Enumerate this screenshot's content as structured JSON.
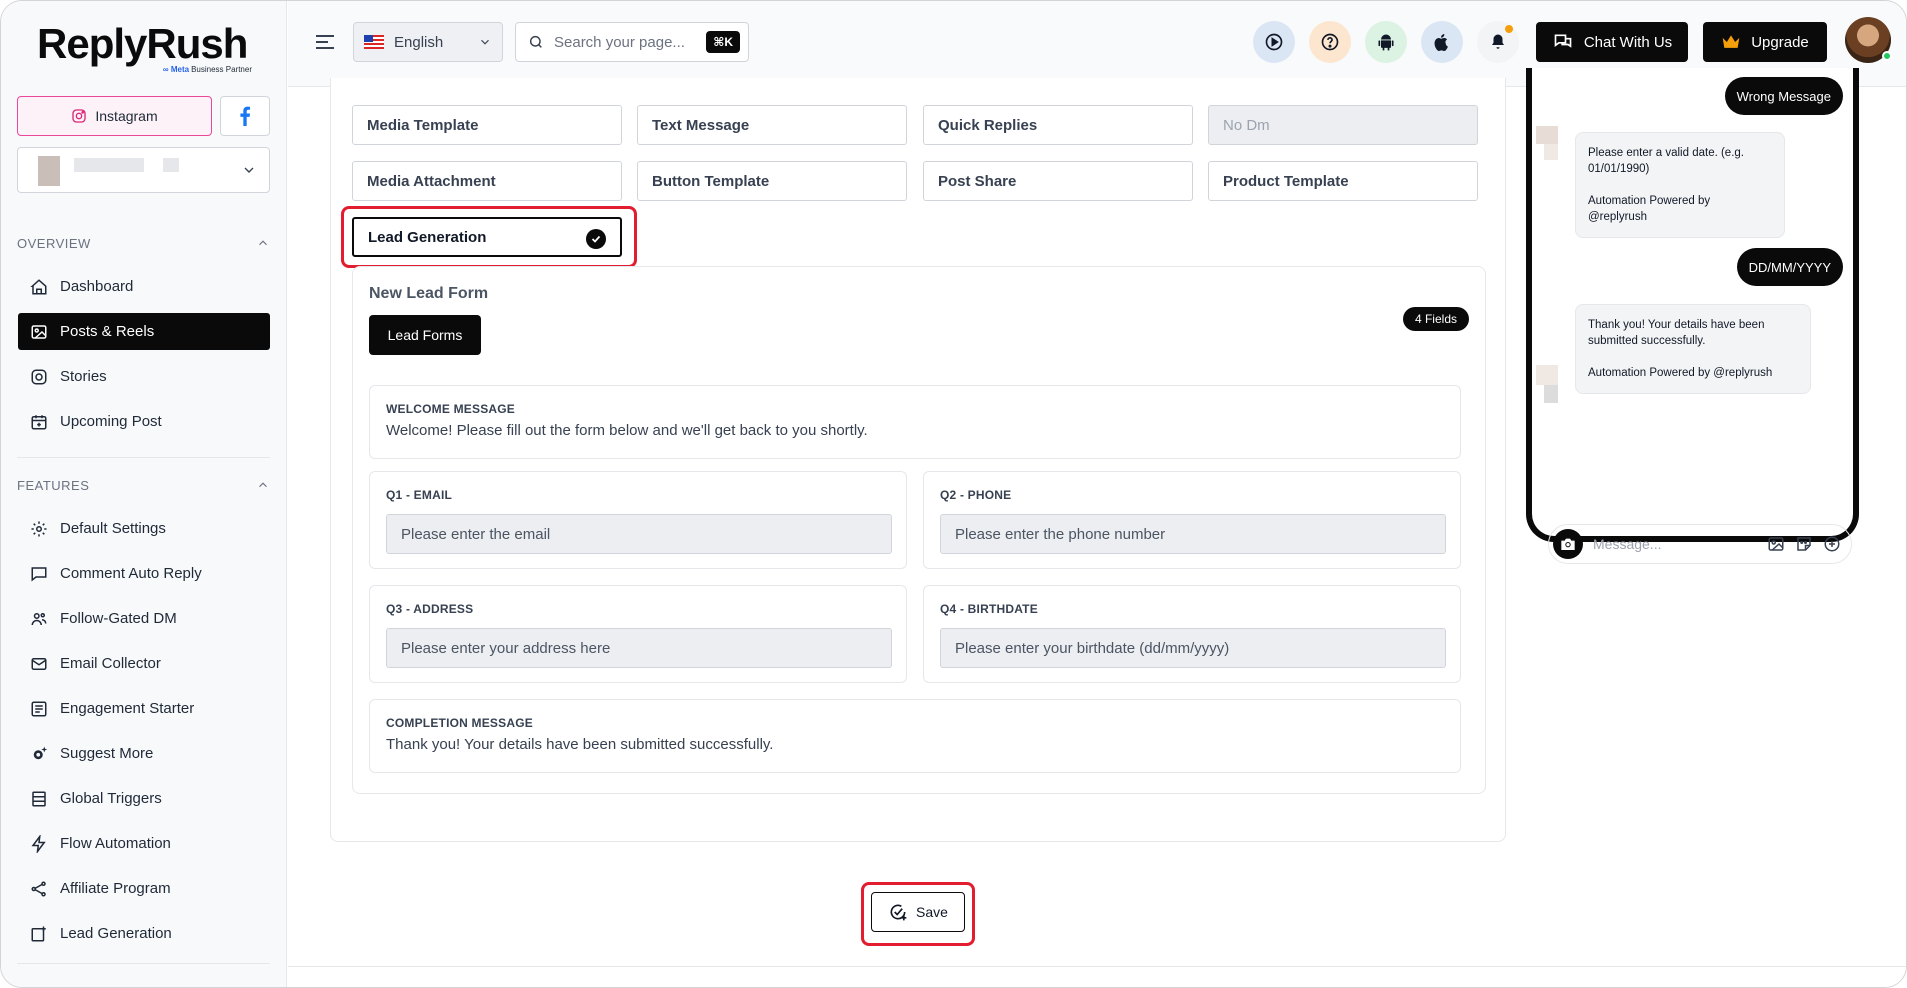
{
  "brand": {
    "name": "ReplyRush",
    "tagline_prefix": "∞ Meta",
    "tagline": "Business Partner"
  },
  "account": {
    "instagram_label": "Instagram"
  },
  "sidebar": {
    "overview_label": "OVERVIEW",
    "overview_items": [
      {
        "label": "Dashboard",
        "icon": "home-icon"
      },
      {
        "label": "Posts & Reels",
        "icon": "image-icon",
        "active": true
      },
      {
        "label": "Stories",
        "icon": "instagram-icon"
      },
      {
        "label": "Upcoming Post",
        "icon": "calendar-plus-icon"
      }
    ],
    "features_label": "FEATURES",
    "feature_items": [
      {
        "label": "Default Settings",
        "icon": "gear-icon"
      },
      {
        "label": "Comment Auto Reply",
        "icon": "comment-icon"
      },
      {
        "label": "Follow-Gated DM",
        "icon": "users-icon"
      },
      {
        "label": "Email Collector",
        "icon": "mail-icon"
      },
      {
        "label": "Engagement Starter",
        "icon": "list-icon"
      },
      {
        "label": "Suggest More",
        "icon": "sparkle-gear-icon"
      },
      {
        "label": "Global Triggers",
        "icon": "server-icon"
      },
      {
        "label": "Flow Automation",
        "icon": "bolt-icon"
      },
      {
        "label": "Affiliate Program",
        "icon": "share-icon"
      },
      {
        "label": "Lead Generation",
        "icon": "lead-icon"
      }
    ]
  },
  "header": {
    "language": "English",
    "search_placeholder": "Search your page...",
    "search_shortcut": "⌘K",
    "chat_label": "Chat With Us",
    "upgrade_label": "Upgrade"
  },
  "message_types": [
    {
      "label": "Media Template"
    },
    {
      "label": "Text Message"
    },
    {
      "label": "Quick Replies"
    },
    {
      "label": "No Dm",
      "disabled": true
    },
    {
      "label": "Media Attachment"
    },
    {
      "label": "Button Template"
    },
    {
      "label": "Post Share"
    },
    {
      "label": "Product Template"
    },
    {
      "label": "Lead Generation",
      "selected": true
    }
  ],
  "lead_form": {
    "title": "New Lead Form",
    "lead_forms_button": "Lead Forms",
    "fields_badge": "4 Fields",
    "welcome": {
      "label": "WELCOME MESSAGE",
      "text": "Welcome! Please fill out the form below and we'll get back to you shortly."
    },
    "questions": [
      {
        "label": "Q1 - EMAIL",
        "placeholder": "Please enter the email"
      },
      {
        "label": "Q2 - PHONE",
        "placeholder": "Please enter the phone number"
      },
      {
        "label": "Q3 - ADDRESS",
        "placeholder": "Please enter your address here"
      },
      {
        "label": "Q4 - BIRTHDATE",
        "placeholder": "Please enter your birthdate (dd/mm/yyyy)"
      }
    ],
    "completion": {
      "label": "COMPLETION MESSAGE",
      "text": "Thank you! Your details have been submitted successfully."
    }
  },
  "save_label": "Save",
  "preview": {
    "msg_wrong": "Wrong Message",
    "msg_invalid_date": "Please enter a valid date. (e.g.\n01/01/1990)\n\nAutomation Powered by\n@replyrush",
    "msg_date": "DD/MM/YYYY",
    "msg_thanks": "Thank you! Your details have been\nsubmitted successfully.\n\nAutomation Powered by @replyrush",
    "composer_placeholder": "Message..."
  },
  "colors": {
    "accent": "#0a0a0a",
    "highlight": "#e11d2f",
    "instagram": "#ec4899",
    "facebook": "#1877f2"
  }
}
